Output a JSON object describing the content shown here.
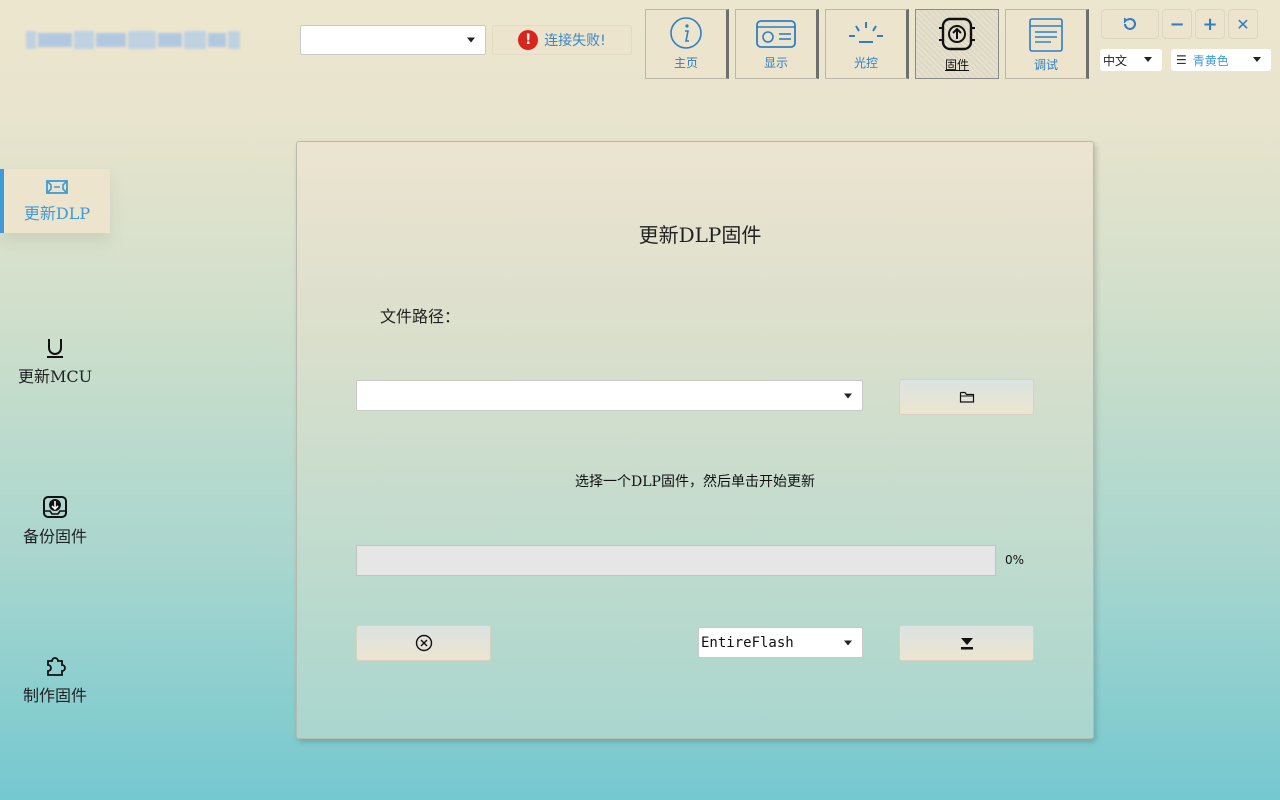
{
  "header": {
    "device_select_value": "",
    "connection_status": "连接失败!",
    "nav_tabs": [
      {
        "label": "主页",
        "icon": "info-icon"
      },
      {
        "label": "显示",
        "icon": "display-icon"
      },
      {
        "label": "光控",
        "icon": "light-icon"
      },
      {
        "label": "固件",
        "icon": "chip-upload-icon",
        "active": true
      },
      {
        "label": "调试",
        "icon": "document-icon"
      }
    ],
    "language": "中文",
    "theme": "青黄色",
    "window_buttons": [
      "refresh-icon",
      "minimize-icon",
      "maximize-icon",
      "close-icon"
    ]
  },
  "sidebar": {
    "items": [
      {
        "label": "更新DLP",
        "icon": "dlp-icon",
        "active": true
      },
      {
        "label": "更新MCU",
        "icon": "u-icon"
      },
      {
        "label": "备份固件",
        "icon": "inbox-download-icon"
      },
      {
        "label": "制作固件",
        "icon": "puzzle-icon"
      }
    ]
  },
  "main": {
    "title": "更新DLP固件",
    "file_path_label": "文件路径：",
    "file_path_value": "",
    "hint": "选择一个DLP固件，然后单击开始更新",
    "progress_percent": 0,
    "progress_text": "0%",
    "flash_mode": "EntireFlash"
  },
  "colors": {
    "accent": "#3f9ad8",
    "error": "#d9261c",
    "button_bg": "#ece4cd"
  }
}
